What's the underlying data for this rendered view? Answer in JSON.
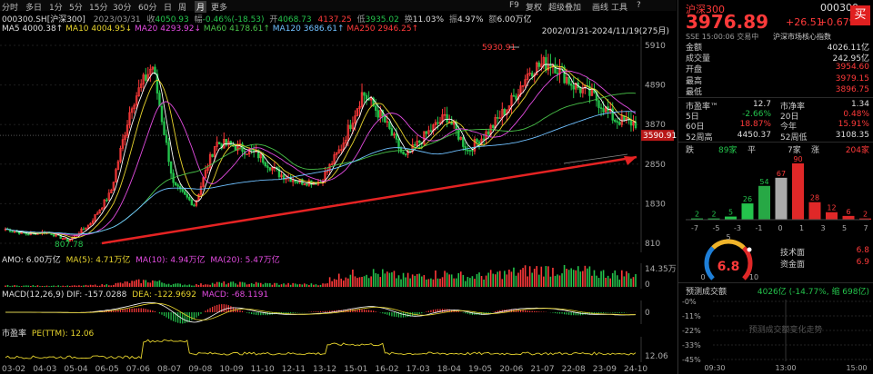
{
  "toolbar": {
    "periods": [
      "分时",
      "多日",
      "1分",
      "5分",
      "15分",
      "30分",
      "60分",
      "日",
      "周",
      "月",
      "更多"
    ],
    "active_period": "月",
    "right_items": [
      "F9",
      "复权",
      "超级叠加",
      "画线",
      "工具",
      "?"
    ]
  },
  "info": {
    "code": "000300.SH[沪深300]",
    "date": "2023/03/31",
    "close_label": "收",
    "close": "4050.93",
    "change_label": "幅",
    "change": "-0.46%(-18.53)",
    "open_label": "开",
    "open": "4068.73",
    "high": "4137.25",
    "low_label": "低",
    "low": "3935.02",
    "turnover_label": "换",
    "turnover": "11.03%",
    "amp_label": "振",
    "amp": "4.97%",
    "amount_label": "额",
    "amount": "6.00万亿",
    "ma5": "MA5 4000.38↑",
    "ma10": "MA10 4004.95↓",
    "ma20": "MA20 4293.92↓",
    "ma60": "MA60 4178.61↑",
    "ma120": "MA120 3686.61↑",
    "ma250": "MA250 2946.25↑",
    "range": "2002/01/31-2024/11/19(275月)"
  },
  "chart_data": [
    {
      "type": "line",
      "title": "",
      "annotations": {
        "peak": "5930.91",
        "trough": "807.78",
        "current": "3590.91"
      },
      "ylabels": [
        "5910",
        "4890",
        "3870",
        "2850",
        "1830",
        "810"
      ],
      "xlabels": [
        "03-02",
        "04-03",
        "05-04",
        "06-05",
        "07-06",
        "08-07",
        "09-08",
        "10-09",
        "11-10",
        "12-11",
        "13-12",
        "15-01",
        "16-02",
        "17-03",
        "18-04",
        "19-05",
        "20-06",
        "21-07",
        "22-08",
        "23-09",
        "24-10"
      ],
      "series": [],
      "x": [
        "2002",
        "2003",
        "2004",
        "2005",
        "2006",
        "2007",
        "2007.5",
        "2008",
        "2008.5",
        "2009",
        "2009.5",
        "2010",
        "2011",
        "2012",
        "2013",
        "2014",
        "2014.5",
        "2015",
        "2015.5",
        "2016",
        "2017",
        "2018",
        "2018.5",
        "2019",
        "2020",
        "2020.5",
        "2021",
        "2021.5",
        "2022",
        "2023",
        "2024"
      ],
      "close": [
        1180,
        1050,
        1100,
        880,
        1300,
        2100,
        4400,
        5400,
        2300,
        1800,
        3400,
        3300,
        3100,
        2600,
        2400,
        2400,
        3300,
        4700,
        4000,
        3000,
        3600,
        4100,
        3200,
        3700,
        4400,
        5300,
        5500,
        4900,
        4600,
        4000,
        3900
      ],
      "ylim": [
        810,
        5910
      ]
    },
    {
      "type": "bar",
      "title": "AMO",
      "values": [
        "6.00万亿",
        "4.71万亿",
        "4.94万亿",
        "5.47万亿"
      ],
      "ylabels": [
        "14.35万亿",
        "0"
      ]
    },
    {
      "type": "line",
      "title": "MACD",
      "values": [
        "-157.0288",
        "-122.9692",
        "-68.1191"
      ],
      "ylabels": [
        "0"
      ]
    },
    {
      "type": "line",
      "title": "市盈率",
      "values": [
        "12.06"
      ],
      "ylabels": [
        "12.06"
      ]
    }
  ],
  "amo": {
    "label": "AMO: 6.00万亿",
    "ma5": "MA(5): 4.71万亿",
    "ma10": "MA(10): 4.94万亿",
    "ma20": "MA(20): 5.47万亿",
    "ymax": "14.35万亿",
    "zero": "0"
  },
  "macd": {
    "label": "MACD(12,26,9) DIF: -157.0288",
    "dea": "DEA: -122.9692",
    "macd": "MACD: -68.1191",
    "zero": "0"
  },
  "pe": {
    "label": "市盈率",
    "val": "PE(TTM): 12.06",
    "y1": "12.06"
  },
  "right": {
    "name": "沪深300",
    "code": "000300",
    "price": "3976.89",
    "chg": "+26.51",
    "pct": "+0.67%",
    "buy": "买",
    "sub": "SSE  15:00:06  交易中",
    "sub2": "沪深市场核心指数",
    "rows": [
      {
        "k": "金额",
        "v": "4026.11亿",
        "c": "#ddd"
      },
      {
        "k": "成交量",
        "v": "242.95亿",
        "c": "#ddd"
      },
      {
        "k": "开盘",
        "v": "3954.60",
        "c": "#ff3a3a"
      },
      {
        "k": "最高",
        "v": "3979.15",
        "c": "#ff3a3a"
      },
      {
        "k": "最低",
        "v": "3896.75",
        "c": "#ff3a3a"
      }
    ],
    "stats": [
      {
        "k1": "市盈率™",
        "v1": "12.7",
        "c1": "#ddd",
        "k2": "市净率",
        "v2": "1.34",
        "c2": "#ddd"
      },
      {
        "k1": "5日",
        "v1": "-2.66%",
        "c1": "#24c34c",
        "k2": "20日",
        "v2": "0.48%",
        "c2": "#ff3a3a"
      },
      {
        "k1": "60日",
        "v1": "18.87%",
        "c1": "#ff3a3a",
        "k2": "今年",
        "v2": "15.91%",
        "c2": "#ff3a3a"
      },
      {
        "k1": "52周高",
        "v1": "4450.37",
        "c1": "#ddd",
        "k2": "52周低",
        "v2": "3108.35",
        "c2": "#ddd"
      }
    ],
    "dist": {
      "fall_label": "跌",
      "fall": "89家",
      "flat_label": "平",
      "flat": "7家",
      "rise_label": "涨",
      "rise": "204家"
    },
    "bars": {
      "values": [
        2,
        2,
        5,
        26,
        54,
        67,
        90,
        28,
        12,
        6,
        2
      ],
      "axis": [
        "-7",
        "-5",
        "-3",
        "-1",
        "0",
        "1",
        "3",
        "5",
        "7"
      ]
    },
    "gauge": {
      "score": "6.8",
      "min": "0",
      "max": "10",
      "a": "5",
      "tech_label": "技术面",
      "tech": "6.8",
      "fund_label": "资金面",
      "fund": "6.9"
    },
    "pred": {
      "title": "预测成交额",
      "val": "4026亿 (-14.77%, 缩 698亿)",
      "ticks": [
        "-0%",
        "-11%",
        "-22%",
        "-33%",
        "-45%"
      ],
      "times": [
        "09:30",
        "13:00",
        "15:00"
      ],
      "watermark": "预测成交额变化走势"
    }
  },
  "colors": {
    "up": "#ff3a3a",
    "down": "#24c34c",
    "ma5": "#ffffff",
    "ma10": "#e6d32d",
    "ma20": "#e24be0",
    "ma60": "#48c048",
    "ma120": "#6fc0ff"
  }
}
